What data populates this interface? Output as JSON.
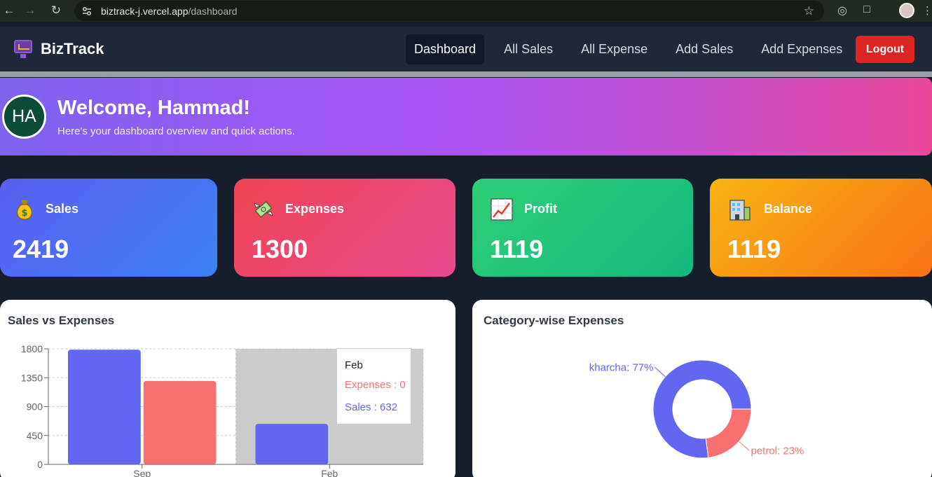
{
  "browser": {
    "url_host": "biztrack-j.vercel.app",
    "url_path": "/dashboard"
  },
  "navbar": {
    "brand": "BizTrack",
    "links": [
      {
        "label": "Dashboard",
        "active": true
      },
      {
        "label": "All Sales",
        "active": false
      },
      {
        "label": "All Expense",
        "active": false
      },
      {
        "label": "Add Sales",
        "active": false
      },
      {
        "label": "Add Expenses",
        "active": false
      }
    ],
    "logout_label": "Logout",
    "logout_color": "#dc2626"
  },
  "welcome": {
    "avatar_initials": "HA",
    "title": "Welcome, Hammad!",
    "subtitle": "Here's your dashboard overview and quick actions."
  },
  "stats": {
    "sales": {
      "label": "Sales",
      "value": "2419",
      "icon": "money-bag-icon"
    },
    "expenses": {
      "label": "Expenses",
      "value": "1300",
      "icon": "money-wings-icon"
    },
    "profit": {
      "label": "Profit",
      "value": "1119",
      "icon": "chart-increasing-icon"
    },
    "balance": {
      "label": "Balance",
      "value": "1119",
      "icon": "bank-building-icon"
    }
  },
  "panels": {
    "sales_vs_expenses_title": "Sales vs Expenses",
    "category_title": "Category-wise Expenses"
  },
  "tooltip": {
    "title": "Feb",
    "expenses": "Expenses : 0",
    "sales": "Sales : 632"
  },
  "chart_data": [
    {
      "type": "bar",
      "title": "Sales vs Expenses",
      "categories": [
        "Sep",
        "Feb"
      ],
      "series": [
        {
          "name": "Sales",
          "values": [
            1787,
            632
          ],
          "color": "#6366f1"
        },
        {
          "name": "Expenses",
          "values": [
            1300,
            0
          ],
          "color": "#f87171"
        }
      ],
      "yticks": [
        0,
        450,
        900,
        1350,
        1800
      ],
      "ylim": [
        0,
        1800
      ],
      "grid": true,
      "highlighted_category": "Feb"
    },
    {
      "type": "pie",
      "title": "Category-wise Expenses",
      "donut": true,
      "slices": [
        {
          "label": "kharcha: 77%",
          "value": 77,
          "color": "#6366f1"
        },
        {
          "label": "petrol: 23%",
          "value": 23,
          "color": "#f87171"
        }
      ]
    }
  ]
}
